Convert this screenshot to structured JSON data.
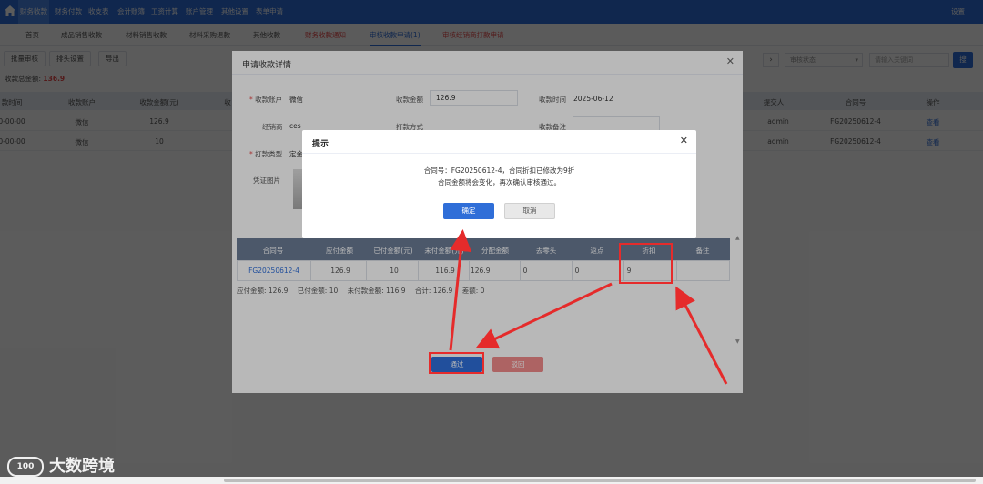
{
  "topnav": {
    "items": [
      "财务收款",
      "财务付款",
      "收支表",
      "会计账簿",
      "工资计算",
      "账户管理",
      "其他设置",
      "表单申请"
    ],
    "settings": "设置"
  },
  "tabs": [
    "首页",
    "成品销售收款",
    "材料销售收款",
    "材料采购退款",
    "其他收款",
    "财务收款通知",
    "审核收款申请(1)",
    "审核经销商打款申请"
  ],
  "toolbar": {
    "batch_audit": "批量审核",
    "header_settings": "排头设置",
    "export": "导出",
    "audit_status_placeholder": "审核状态",
    "search_placeholder": "请输入关键词",
    "search_btn": "搜"
  },
  "total": {
    "label": "收款总金额:",
    "value": "136.9"
  },
  "grid": {
    "headers": [
      "款时间",
      "收款账户",
      "收款金额(元)",
      "收",
      "提交人",
      "合同号",
      "操作"
    ],
    "rows": [
      {
        "time": "0-00-00",
        "account": "微信",
        "amount": "126.9",
        "submitter": "admin",
        "contract": "FG20250612-4",
        "action": "查看"
      },
      {
        "time": "0-00-00",
        "account": "微信",
        "amount": "10",
        "submitter": "admin",
        "contract": "FG20250612-4",
        "action": "查看"
      }
    ]
  },
  "detail": {
    "title": "申请收款详情",
    "account_label": "收款账户",
    "account_value": "微信",
    "amount_label": "收款金额",
    "amount_value": "126.9",
    "time_label": "收款时间",
    "time_value": "2025-06-12",
    "dealer_label": "经销商",
    "dealer_value": "ces",
    "pay_method_label": "打款方式",
    "remark_label": "收款备注",
    "pay_type_label": "打款类型",
    "pay_type_value": "定金",
    "voucher_label": "凭证图片",
    "table_headers": [
      "合同号",
      "应付金额",
      "已付金额(元)",
      "未付金额(元)",
      "分配金额",
      "去零头",
      "返点",
      "折扣",
      "备注"
    ],
    "table_row": [
      "FG20250612-4",
      "126.9",
      "10",
      "116.9",
      "126.9",
      "0",
      "0",
      "9",
      ""
    ],
    "summary": [
      "应付金额: 126.9",
      "已付金额: 10",
      "未付款金额: 116.9",
      "合计: 126.9",
      "差额: 0"
    ],
    "approve": "通过",
    "reject": "驳回"
  },
  "confirm": {
    "title": "提示",
    "line1": "合同号：FG20250612-4，合同折扣已修改为9折",
    "line2": "合同金额将会变化，再次确认审核通过。",
    "ok": "确定",
    "cancel": "取消"
  },
  "watermark": {
    "logo": "100",
    "text": "大数跨境"
  },
  "colors": {
    "primary": "#2f6ed8",
    "danger": "#e64a4a",
    "annotation": "#e52b2b"
  }
}
